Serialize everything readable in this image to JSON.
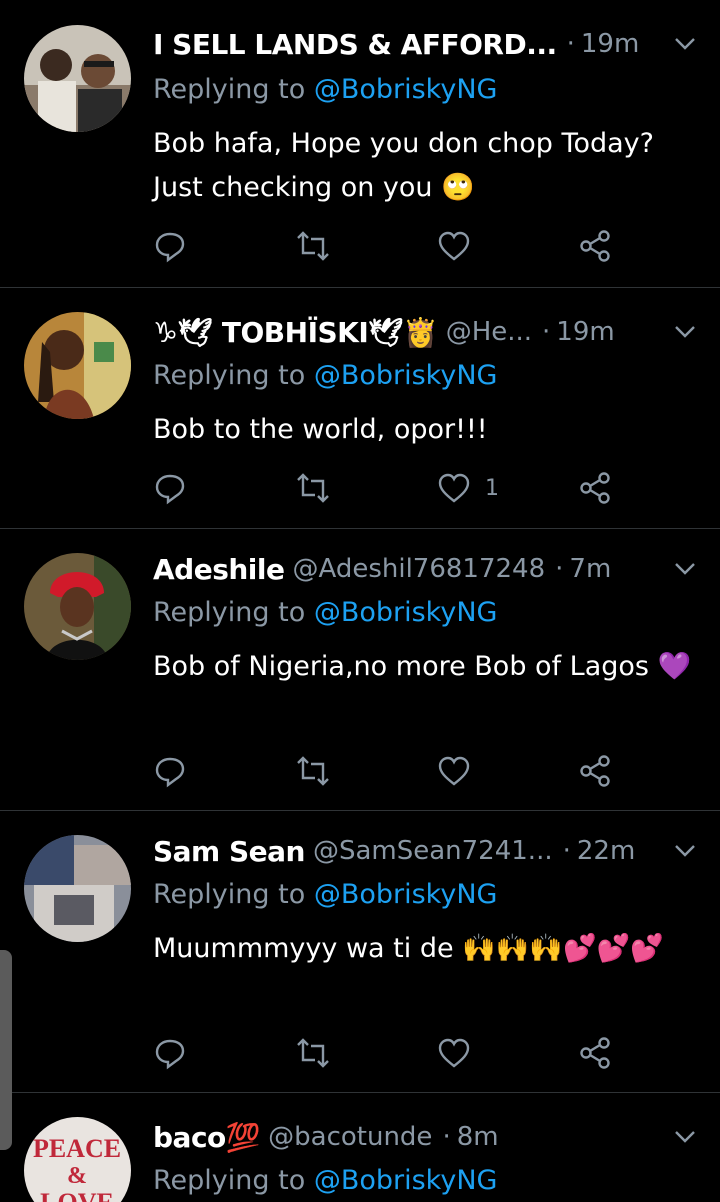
{
  "reply_prefix": "Replying to",
  "tweets": [
    {
      "name": "I SELL LANDS & AFFORD...",
      "handle": "",
      "time": "19m",
      "replying_to": "@BobriskyNG",
      "text": "Bob hafa, Hope you don chop Today? Just checking on you 🙄",
      "likes": ""
    },
    {
      "name": "♑🕊 TOBHÏSKI🕊👸",
      "handle": "@He...",
      "time": "19m",
      "replying_to": "@BobriskyNG",
      "text": "Bob to the world, opor!!!",
      "likes": "1"
    },
    {
      "name": "Adeshile",
      "handle": "@Adeshil76817248",
      "time": "7m",
      "replying_to": "@BobriskyNG",
      "text": "Bob of Nigeria,no more Bob of Lagos 💜",
      "likes": ""
    },
    {
      "name": "Sam Sean",
      "handle": "@SamSean7241...",
      "time": "22m",
      "replying_to": "@BobriskyNG",
      "text": "Muummmyyy wa ti de 🙌🙌🙌💕💕💕",
      "likes": ""
    },
    {
      "name": "baco💯",
      "handle": "@bacotunde",
      "time": "8m",
      "replying_to": "@BobriskyNG",
      "text": "",
      "likes": "",
      "avatar_text": "PEACE & LOVE"
    }
  ],
  "colors": {
    "background": "#000000",
    "secondary_text": "#8b98a5",
    "mention": "#1da1f2",
    "divider": "#2f3336"
  },
  "icons": [
    "reply-icon",
    "retweet-icon",
    "like-icon",
    "share-icon",
    "chevron-down-icon"
  ]
}
